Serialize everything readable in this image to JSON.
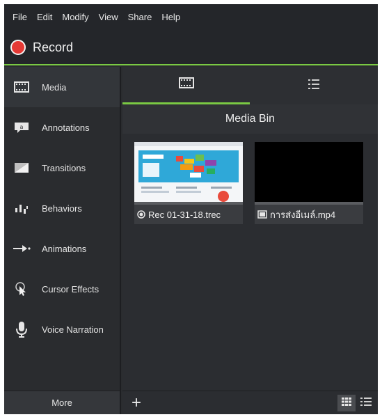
{
  "menu": [
    "File",
    "Edit",
    "Modify",
    "View",
    "Share",
    "Help"
  ],
  "record": {
    "label": "Record",
    "color": "#e53935"
  },
  "accent_color": "#7ac943",
  "sidebar": {
    "items": [
      {
        "label": "Media",
        "icon": "film-strip-icon"
      },
      {
        "label": "Annotations",
        "icon": "annotation-callout-icon"
      },
      {
        "label": "Transitions",
        "icon": "transition-icon"
      },
      {
        "label": "Behaviors",
        "icon": "behaviors-icon"
      },
      {
        "label": "Animations",
        "icon": "animation-arrow-icon"
      },
      {
        "label": "Cursor Effects",
        "icon": "cursor-effects-icon"
      },
      {
        "label": "Voice Narration",
        "icon": "microphone-icon"
      }
    ],
    "more_label": "More"
  },
  "main": {
    "tabs": [
      {
        "icon": "film-strip-icon",
        "active": true
      },
      {
        "icon": "list-icon",
        "active": false
      }
    ],
    "bin_title": "Media Bin",
    "media": [
      {
        "name": "Rec 01-31-18.trec",
        "icon": "recording-icon"
      },
      {
        "name": "การส่งอีเมล์.mp4",
        "icon": "video-file-icon"
      }
    ],
    "add_label": "+",
    "view_modes": [
      "grid-view-icon",
      "list-view-icon"
    ]
  }
}
